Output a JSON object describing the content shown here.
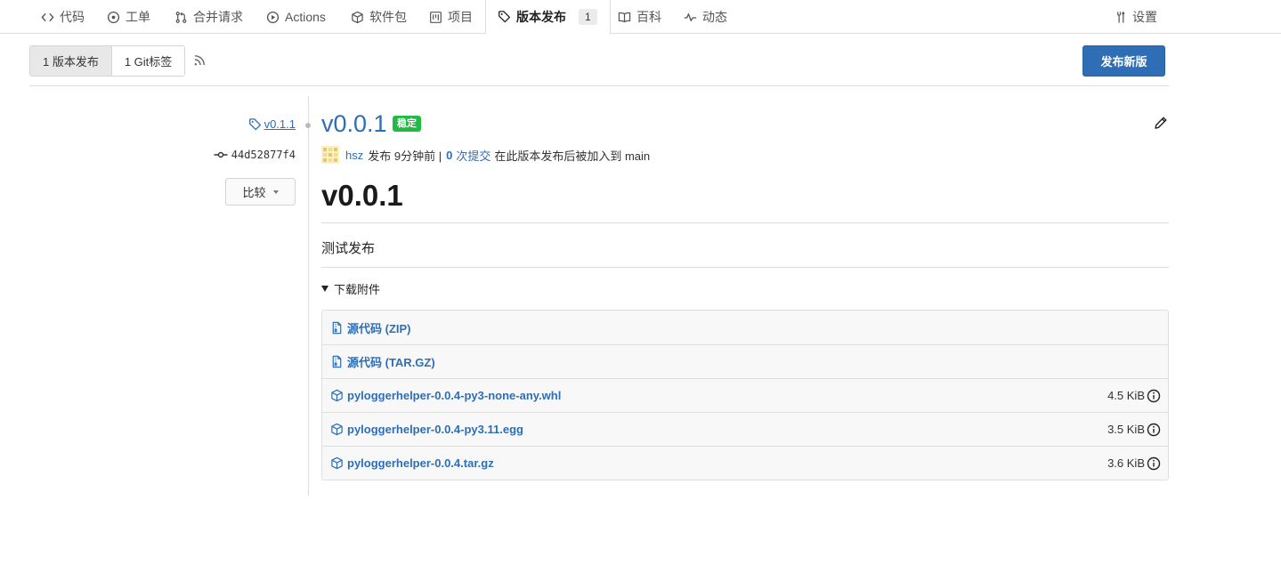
{
  "nav": {
    "tabs": [
      {
        "label": "代码",
        "icon": "code-icon"
      },
      {
        "label": "工单",
        "icon": "issue-opened-icon"
      },
      {
        "label": "合并请求",
        "icon": "git-pull-request-icon"
      },
      {
        "label": "Actions",
        "icon": "play-icon"
      },
      {
        "label": "软件包",
        "icon": "package-icon"
      },
      {
        "label": "项目",
        "icon": "project-icon"
      },
      {
        "label": "版本发布",
        "icon": "tag-icon",
        "count": "1",
        "active": true
      },
      {
        "label": "百科",
        "icon": "book-icon"
      },
      {
        "label": "动态",
        "icon": "pulse-icon"
      },
      {
        "label": "设置",
        "icon": "tools-icon"
      }
    ]
  },
  "subheader": {
    "releases_label": "1 版本发布",
    "tags_label": "1 Git标签",
    "rss_icon": "rss-icon",
    "new_release_label": "发布新版"
  },
  "release": {
    "tag": "v0.1.1",
    "sha": "44d52877f4",
    "compare_label": "比较",
    "title": "v0.0.1",
    "badge": "稳定",
    "author": "hsz",
    "published_text": "发布 9分钟前 |",
    "commits_count": "0",
    "commits_label": "次提交",
    "after_text": "在此版本发布后被加入到 main",
    "heading": "v0.0.1",
    "description": "测试发布",
    "downloads_label": "下载附件",
    "assets": [
      {
        "name": "源代码 (ZIP)",
        "icon": "file-zip-icon",
        "size": ""
      },
      {
        "name": "源代码 (TAR.GZ)",
        "icon": "file-zip-icon",
        "size": ""
      },
      {
        "name": "pyloggerhelper-0.0.4-py3-none-any.whl",
        "icon": "package-icon",
        "size": "4.5 KiB"
      },
      {
        "name": "pyloggerhelper-0.0.4-py3.11.egg",
        "icon": "package-icon",
        "size": "3.5 KiB"
      },
      {
        "name": "pyloggerhelper-0.0.4.tar.gz",
        "icon": "package-icon",
        "size": "3.6 KiB"
      }
    ]
  },
  "colors": {
    "link": "#2f6eb5",
    "primary_button": "#2f6eb5",
    "badge_green": "#21ba45",
    "border": "#dedede"
  }
}
